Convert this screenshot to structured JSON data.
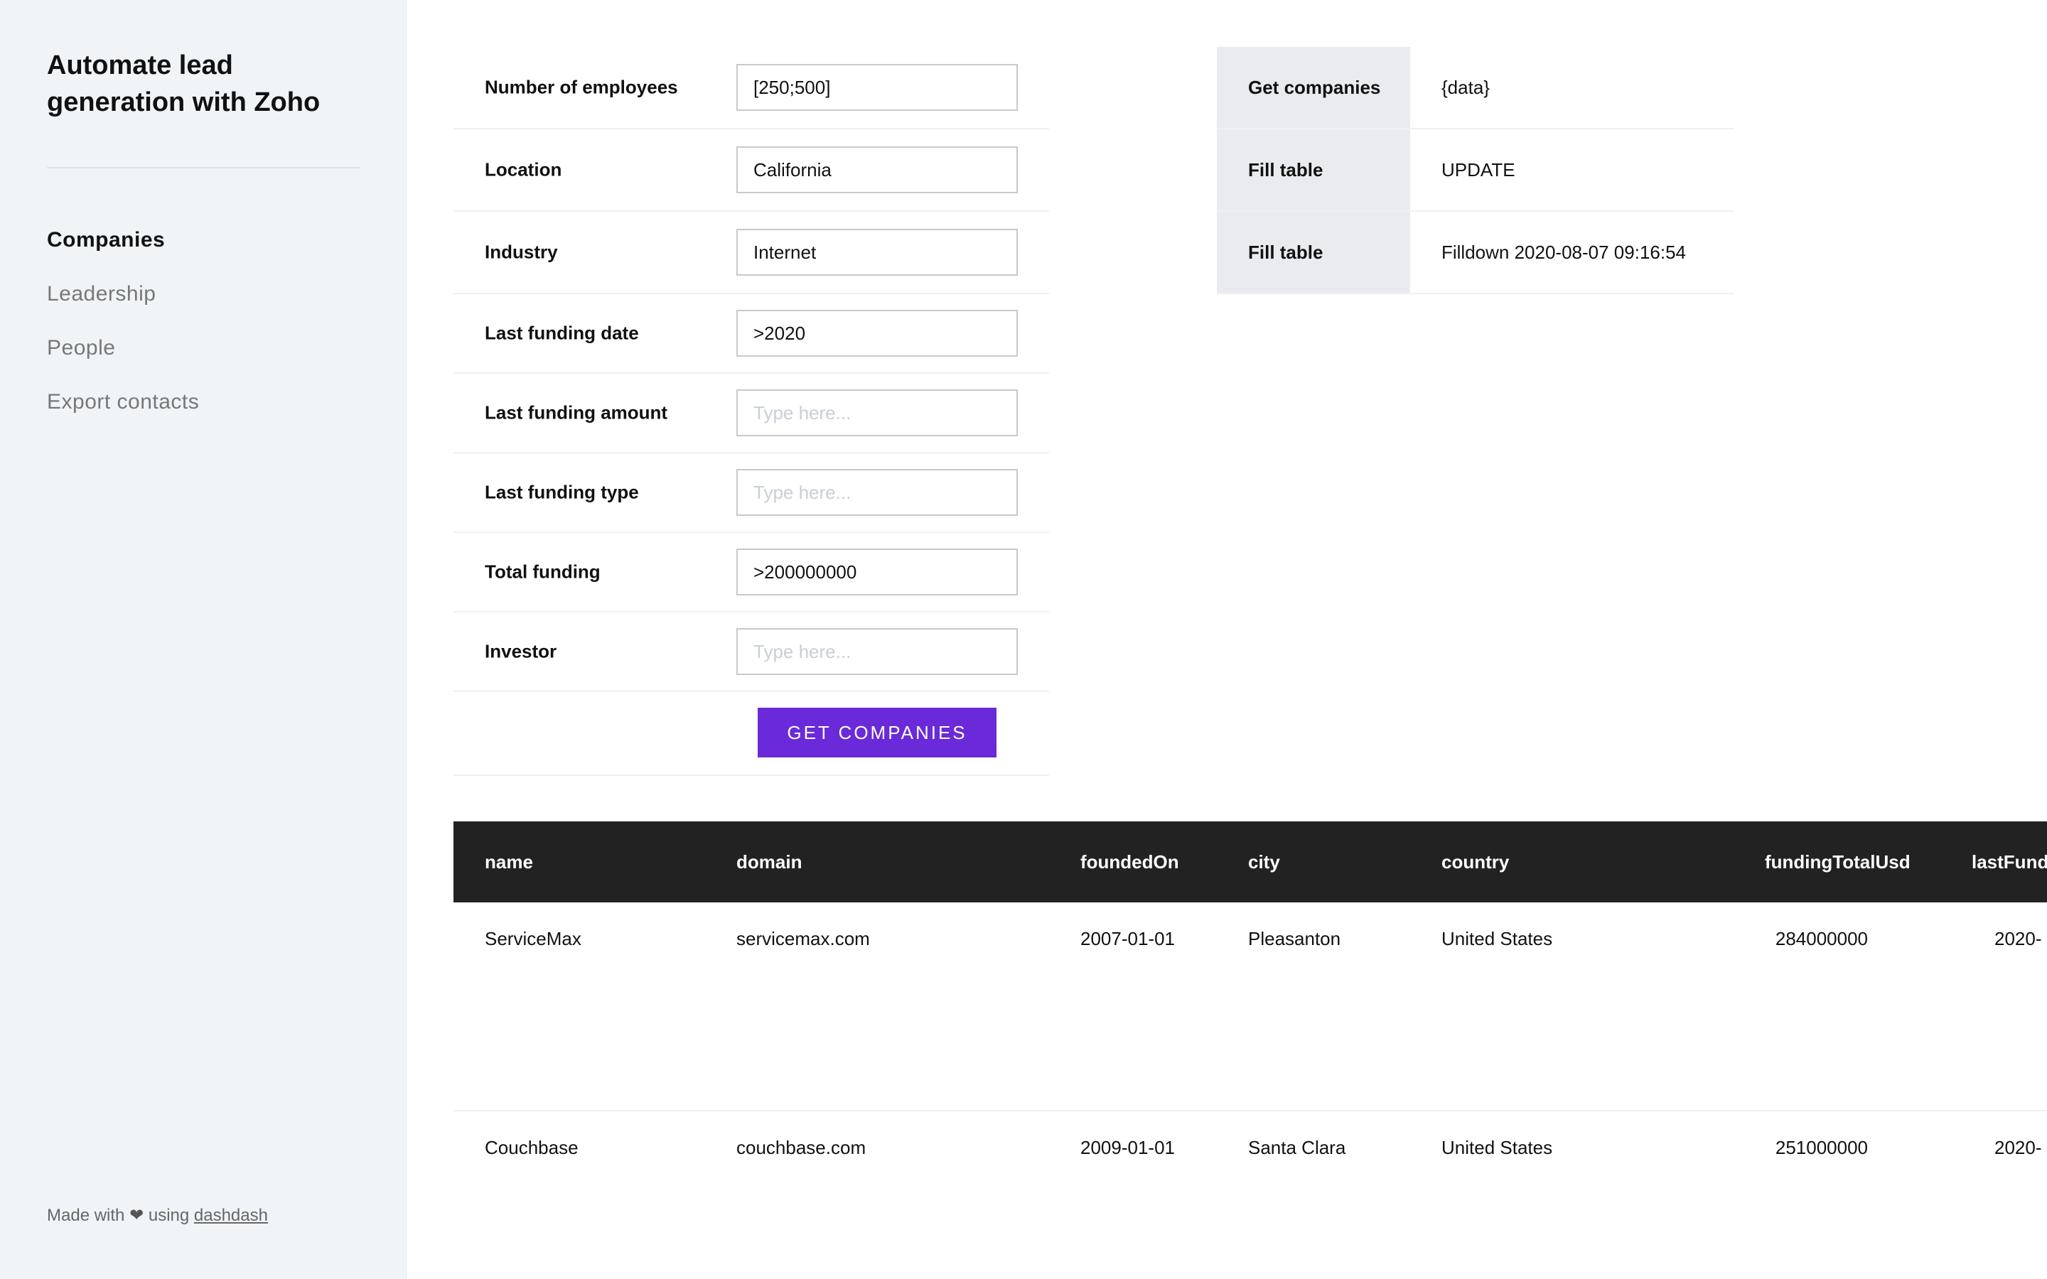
{
  "sidebar": {
    "title": "Automate lead generation with Zoho",
    "nav": [
      {
        "label": "Companies",
        "active": true
      },
      {
        "label": "Leadership",
        "active": false
      },
      {
        "label": "People",
        "active": false
      },
      {
        "label": "Export contacts",
        "active": false
      }
    ],
    "footer": {
      "prefix": "Made with",
      "heart": "❤",
      "middle": "using",
      "link": "dashdash"
    }
  },
  "form": {
    "fields": [
      {
        "label": "Number of employees",
        "value": "[250;500]",
        "placeholder": "Type here..."
      },
      {
        "label": "Location",
        "value": "California",
        "placeholder": "Type here..."
      },
      {
        "label": "Industry",
        "value": "Internet",
        "placeholder": "Type here..."
      },
      {
        "label": "Last funding date",
        "value": ">2020",
        "placeholder": "Type here..."
      },
      {
        "label": "Last funding amount",
        "value": "",
        "placeholder": "Type here..."
      },
      {
        "label": "Last funding type",
        "value": "",
        "placeholder": "Type here..."
      },
      {
        "label": "Total funding",
        "value": ">200000000",
        "placeholder": "Type here..."
      },
      {
        "label": "Investor",
        "value": "",
        "placeholder": "Type here..."
      }
    ],
    "submit_label": "GET COMPANIES"
  },
  "actions": [
    {
      "label": "Get companies",
      "value": "{data}"
    },
    {
      "label": "Fill table",
      "value": "UPDATE"
    },
    {
      "label": "Fill table",
      "value": "Filldown 2020-08-07 09:16:54"
    }
  ],
  "table": {
    "headers": [
      "name",
      "domain",
      "foundedOn",
      "city",
      "country",
      "fundingTotalUsd",
      "lastFund"
    ],
    "rows": [
      [
        "ServiceMax",
        "servicemax.com",
        "2007-01-01",
        "Pleasanton",
        "United States",
        "284000000",
        "2020-"
      ],
      [
        "Couchbase",
        "couchbase.com",
        "2009-01-01",
        "Santa Clara",
        "United States",
        "251000000",
        "2020-"
      ]
    ]
  },
  "colors": {
    "accent": "#6a2ad9",
    "sidebar_bg": "#f0f4f7",
    "table_header_bg": "#222222",
    "action_label_bg": "#e9ebee"
  }
}
